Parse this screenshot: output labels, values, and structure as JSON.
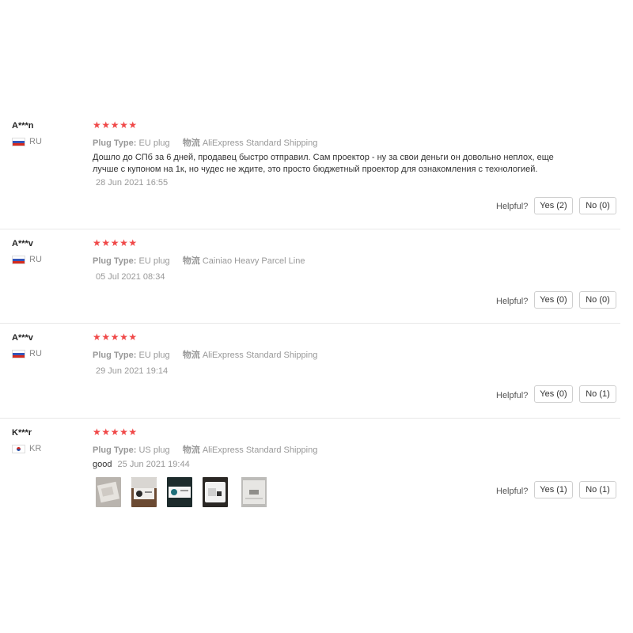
{
  "labels": {
    "plug_type": "Plug Type:",
    "shipping": "物流",
    "helpful": "Helpful?"
  },
  "rating_stars": "★★★★★",
  "reviews": [
    {
      "user": "A***n",
      "country": "RU",
      "rating": 5,
      "plug": "EU plug",
      "shipping": "AliExpress Standard Shipping",
      "text": "Дошло до СПб за 6 дней, продавец быстро отправил. Сам проектор - ну за свои деньги он довольно неплох, еще лучше с купоном на 1к, но чудес не ждите, это просто бюджетный проектор для ознакомления с технологией.",
      "date": "28 Jun 2021 16:55",
      "yes": "Yes (2)",
      "no": "No (0)"
    },
    {
      "user": "A***v",
      "country": "RU",
      "rating": 5,
      "plug": "EU plug",
      "shipping": "Cainiao Heavy Parcel Line",
      "text": "",
      "date": "05 Jul 2021 08:34",
      "yes": "Yes (0)",
      "no": "No (0)"
    },
    {
      "user": "A***v",
      "country": "RU",
      "rating": 5,
      "plug": "EU plug",
      "shipping": "AliExpress Standard Shipping",
      "text": "",
      "date": "29 Jun 2021 19:14",
      "yes": "Yes (0)",
      "no": "No (1)"
    },
    {
      "user": "K***r",
      "country": "KR",
      "rating": 5,
      "plug": "US plug",
      "shipping": "AliExpress Standard Shipping",
      "text": "good",
      "date": "25 Jun 2021 19:44",
      "yes": "Yes (1)",
      "no": "No (1)",
      "photo_count": 5
    }
  ],
  "colors": {
    "star": "#f04848",
    "divider": "#e8e8e8",
    "muted": "#999999"
  }
}
